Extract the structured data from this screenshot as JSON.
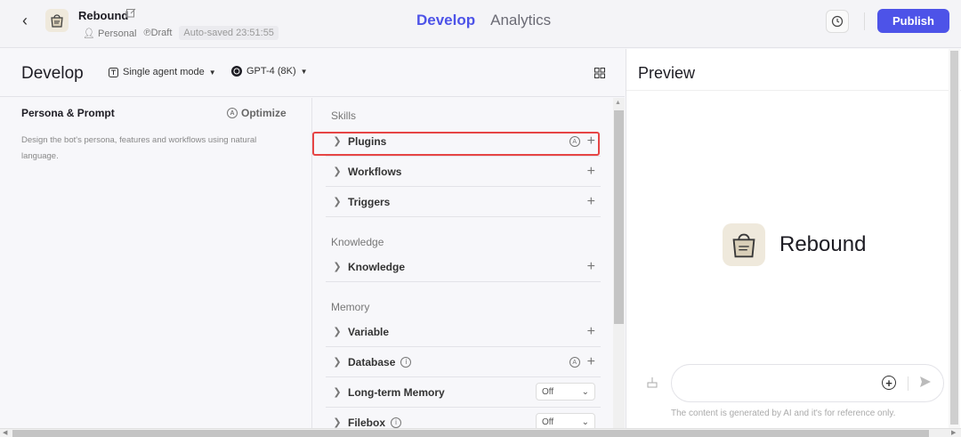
{
  "topbar": {
    "bot_name": "Rebound",
    "owner": "Personal",
    "status": "Draft",
    "saved": "Auto-saved 23:51:55",
    "tabs": [
      {
        "label": "Develop",
        "active": true
      },
      {
        "label": "Analytics",
        "active": false
      }
    ],
    "publish_label": "Publish",
    "accent_color": "#4d53e8"
  },
  "develop": {
    "title": "Develop",
    "mode": "Single agent mode",
    "model": "GPT-4 (8K)"
  },
  "persona": {
    "title": "Persona & Prompt",
    "optimize_label": "Optimize",
    "description": "Design the bot's persona, features and workflows using natural language."
  },
  "skills": {
    "sections": [
      {
        "title": "Skills"
      },
      {
        "title": "Knowledge"
      },
      {
        "title": "Memory"
      }
    ],
    "rows": [
      {
        "label": "Plugins",
        "controls": "auto+add"
      },
      {
        "label": "Workflows",
        "controls": "add"
      },
      {
        "label": "Triggers",
        "controls": "add"
      },
      {
        "label": "Knowledge",
        "controls": "add"
      },
      {
        "label": "Variable",
        "controls": "add"
      },
      {
        "label": "Database",
        "controls": "auto+add",
        "info": true
      },
      {
        "label": "Long-term Memory",
        "controls": "select",
        "value": "Off"
      },
      {
        "label": "Filebox",
        "controls": "select",
        "value": "Off",
        "info": true
      }
    ]
  },
  "preview": {
    "title": "Preview",
    "bot_name": "Rebound",
    "disclaimer": "The content is generated by AI and it's for reference only."
  }
}
